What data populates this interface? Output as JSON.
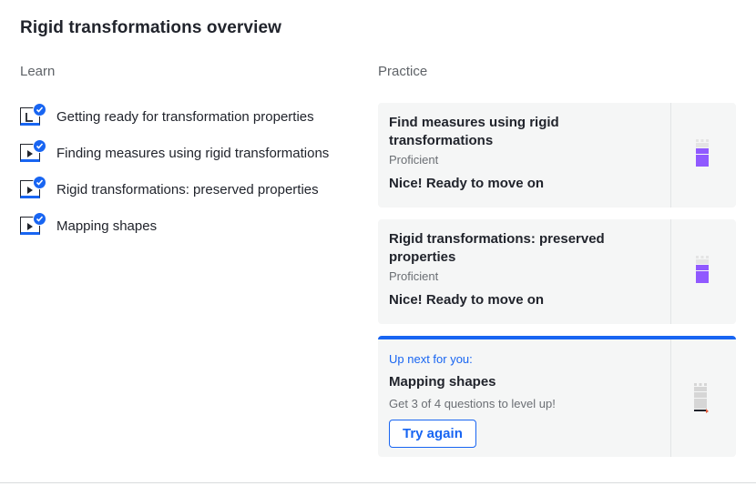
{
  "title": "Rigid transformations overview",
  "learn": {
    "label": "Learn",
    "items": [
      {
        "label": "Getting ready for transformation properties",
        "icon": "article-icon"
      },
      {
        "label": "Finding measures using rigid transformations",
        "icon": "video-icon"
      },
      {
        "label": "Rigid transformations: preserved properties",
        "icon": "video-icon"
      },
      {
        "label": "Mapping shapes",
        "icon": "video-icon"
      }
    ]
  },
  "practice": {
    "label": "Practice",
    "cards": [
      {
        "title": "Find measures using rigid transformations",
        "level": "Proficient",
        "status": "Nice! Ready to move on",
        "mastery_level": 3,
        "mastery_color": "#9059ff"
      },
      {
        "title": "Rigid transformations: preserved properties",
        "level": "Proficient",
        "status": "Nice! Ready to move on",
        "mastery_level": 3,
        "mastery_color": "#9059ff"
      }
    ],
    "up_next": {
      "label": "Up next for you:",
      "title": "Mapping shapes",
      "hint": "Get 3 of 4 questions to level up!",
      "button": "Try again",
      "mastery_level": 0
    }
  },
  "colors": {
    "accent": "#1865f2",
    "proficient": "#9059ff",
    "card_bg": "#f5f6f6"
  }
}
